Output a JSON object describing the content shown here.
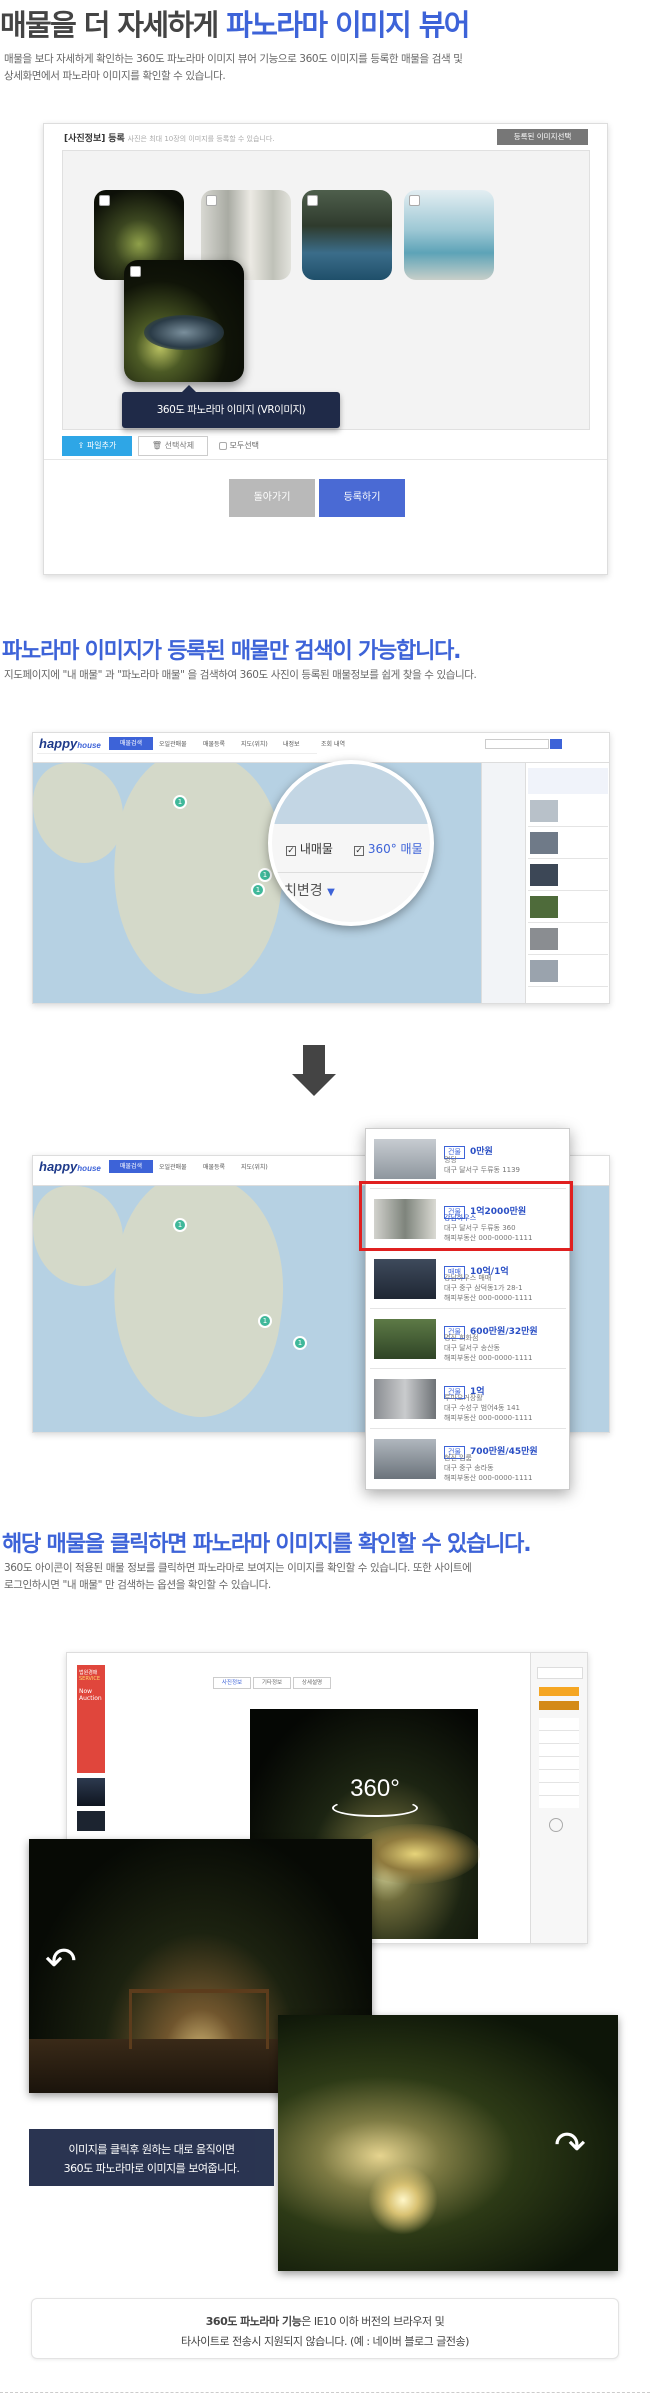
{
  "section1": {
    "title_plain": "매물을 더 자세하게",
    "title_accent": "파노라마 이미지 뷰어",
    "desc_line1": "매물을 보다 자세하게 확인하는 360도 파노라마 이미지 뷰어 기능으로 360도 이미지를 등록한 매물을 검색 및",
    "desc_line2": "상세화면에서 파노라마 이미지를 확인할 수 있습니다.",
    "panel_label": "[사진정보]",
    "panel_reg": "등록",
    "panel_hint": "사진은 최대 10장의 이미지를 등록할 수 있습니다.",
    "panel_button": "등록된 이미지선택",
    "tooltip": "360도 파노라마 이미지 (VR이미지)",
    "add_file": "파일추가",
    "delete_selected": "선택삭제",
    "select_all": "모두선택",
    "back_button": "돌아가기",
    "register_button": "등록하기"
  },
  "section2": {
    "title": "파노라마 이미지가 등록된 매물만 검색이 가능합니다.",
    "desc": "지도페이지에 \"내 매물\" 과 \"파노라마 매물\" 을 검색하여 360도 사진이 등록된 매물정보를 쉽게 찾을 수 있습니다.",
    "logo_main": "happy",
    "logo_sub": "house",
    "zoom_check1": "내매물",
    "zoom_check2": "360° 매물",
    "zoom_bottom": "치변경",
    "map_tabs": [
      "매물검색",
      "오일관매물",
      "매물등록",
      "지도(위치)",
      "내정보",
      "조회 내역"
    ]
  },
  "listings": [
    {
      "tag": "건물",
      "price": "0만원",
      "name": "명당",
      "addr": "대구 달서구 두류동 1139",
      "contact": "해피부동산 000-0000-1111"
    },
    {
      "tag": "건물",
      "price": "1억2000만원",
      "name": "강남하우스",
      "addr": "대구 달서구 두류동 360",
      "contact": "해피부동산 000-0000-1111"
    },
    {
      "tag": "매매",
      "price": "10억/1억",
      "name": "강남하우스 매매",
      "addr": "대구 중구 삼덕동1가 28-1",
      "contact": "해피부동산 000-0000-1111"
    },
    {
      "tag": "건물",
      "price": "600만원/32만원",
      "name": "명진 회화점",
      "addr": "대구 달서구 송산동",
      "contact": "해피부동산 000-0000-1111"
    },
    {
      "tag": "건물",
      "price": "1억",
      "name": "루마오거장활",
      "addr": "대구 수성구 범어4동 141",
      "contact": "해피부동산 000-0000-1111"
    },
    {
      "tag": "건물",
      "price": "700만원/45만원",
      "name": "현진 임룸",
      "addr": "대구 중구 송라동",
      "contact": "해피부동산 000-0000-1111"
    }
  ],
  "section3": {
    "title": "해당 매물을 클릭하면 파노라마 이미지를 확인할 수 있습니다.",
    "desc_line1": "360도 아이콘이 적용된 매물 정보를 클릭하면 파노라마로 보여지는 이미지를 확인할 수 있습니다. 또한 사이트에",
    "desc_line2": "로그인하시면 \"내 매물\" 만 검색하는 옵션을 확인할 수 있습니다.",
    "banner_line1": "법원경매",
    "banner_line2": "SERVICE",
    "banner_line3": "Now",
    "banner_line4": "Auction",
    "detail_tabs": [
      "사진정보",
      "기타정보",
      "상세설명"
    ],
    "badge_360": "360°",
    "caption_line1": "이미지를 클릭후 원하는 대로 움직이면",
    "caption_line2": "360도 파노라마로 이미지를 보여줍니다.",
    "note_bold": "360도 파노라마 기능",
    "note_rest": "은 IE10 이하 버전의 브라우저 및",
    "note_line2": "타사이트로 전송시 지원되지 않습니다. (예 : 네이버 블로그 글전송)"
  },
  "colors": {
    "accent": "#3d63d8",
    "highlight": "#e02020",
    "caption_bg": "#1f2a48"
  }
}
